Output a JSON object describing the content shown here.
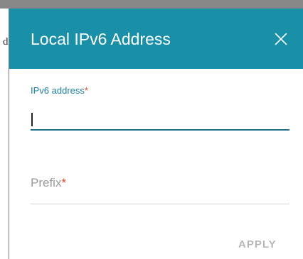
{
  "backdrop": {
    "partial_text": "d"
  },
  "dialog": {
    "title": "Local IPv6 Address",
    "close_icon": "close-icon",
    "header_color": "#1a8fa8"
  },
  "fields": {
    "ipv6_address": {
      "label": "IPv6 address",
      "required_mark": "*",
      "value": ""
    },
    "prefix": {
      "label": "Prefix",
      "required_mark": "*",
      "value": ""
    }
  },
  "actions": {
    "apply_label": "APPLY"
  },
  "colors": {
    "accent": "#1f7fa0",
    "required": "#e0452a",
    "disabled_text": "#b7b7b7"
  }
}
